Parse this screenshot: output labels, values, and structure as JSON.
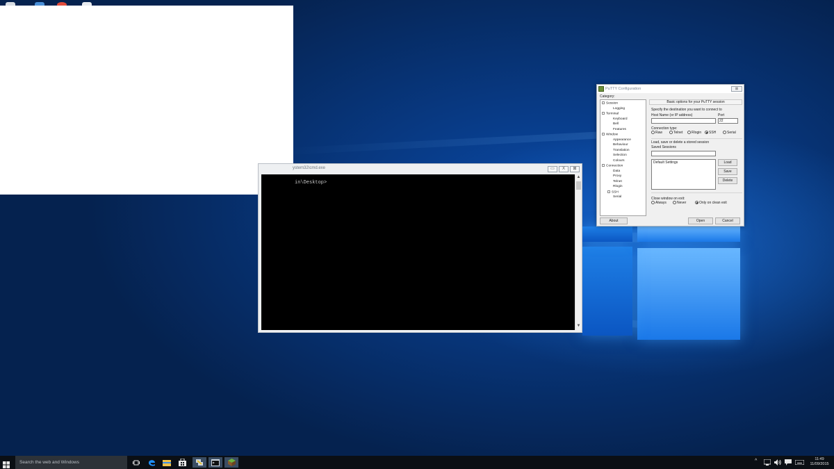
{
  "desktop": {
    "cmd_window": {
      "title": "ystem32\\cmd.exe",
      "prompt": "in\\Desktop>",
      "controls": {
        "minimize": "▭",
        "maximize": "X",
        "close": "⊠"
      },
      "scroll_up": "▲",
      "scroll_down": "▼"
    },
    "putty": {
      "title": "PuTTY Configuration",
      "close_label": "⊠",
      "category_label": "Category:",
      "tree": [
        {
          "label": "Session",
          "level": 0,
          "expander": "–"
        },
        {
          "label": "Logging",
          "level": 2
        },
        {
          "label": "Terminal",
          "level": 0,
          "expander": "–"
        },
        {
          "label": "Keyboard",
          "level": 2
        },
        {
          "label": "Bell",
          "level": 2
        },
        {
          "label": "Features",
          "level": 2
        },
        {
          "label": "Window",
          "level": 0,
          "expander": "–"
        },
        {
          "label": "Appearance",
          "level": 2
        },
        {
          "label": "Behaviour",
          "level": 2
        },
        {
          "label": "Translation",
          "level": 2
        },
        {
          "label": "Selection",
          "level": 2
        },
        {
          "label": "Colours",
          "level": 2
        },
        {
          "label": "Connection",
          "level": 0,
          "expander": "–"
        },
        {
          "label": "Data",
          "level": 2
        },
        {
          "label": "Proxy",
          "level": 2
        },
        {
          "label": "Telnet",
          "level": 2
        },
        {
          "label": "Rlogin",
          "level": 2
        },
        {
          "label": "SSH",
          "level": 1,
          "expander": "+"
        },
        {
          "label": "Serial",
          "level": 2
        }
      ],
      "header": "Basic options for your PuTTY session",
      "destination_label": "Specify the destination you want to connect to",
      "host_label": "Host Name (or IP address)",
      "host_value": "",
      "port_label": "Port",
      "port_value": "22",
      "conn_type_label": "Connection type:",
      "conn_types": [
        {
          "label": "Raw",
          "selected": false
        },
        {
          "label": "Telnet",
          "selected": false
        },
        {
          "label": "Rlogin",
          "selected": false
        },
        {
          "label": "SSH",
          "selected": true
        },
        {
          "label": "Serial",
          "selected": false
        }
      ],
      "sessions_group_label": "Load, save or delete a stored session",
      "saved_sessions_label": "Saved Sessions",
      "saved_sessions_value": "",
      "sessions_list": [
        "Default Settings"
      ],
      "load_label": "Load",
      "save_label": "Save",
      "delete_label": "Delete",
      "close_on_exit_label": "Close window on exit:",
      "exit_options": [
        {
          "label": "Always",
          "selected": false
        },
        {
          "label": "Never",
          "selected": false
        },
        {
          "label": "Only on clean exit",
          "selected": true
        }
      ],
      "about_label": "About",
      "open_label": "Open",
      "cancel_label": "Cancel"
    }
  },
  "taskbar": {
    "search_placeholder": "Search the web and Windows",
    "icons": [
      "task-view-icon",
      "edge-icon",
      "file-explorer-icon",
      "store-icon",
      "putty-icon",
      "cmd-icon",
      "minecraft-icon"
    ],
    "tray": {
      "chevron": "^",
      "time": "11:49",
      "date": "11/09/2015"
    }
  }
}
